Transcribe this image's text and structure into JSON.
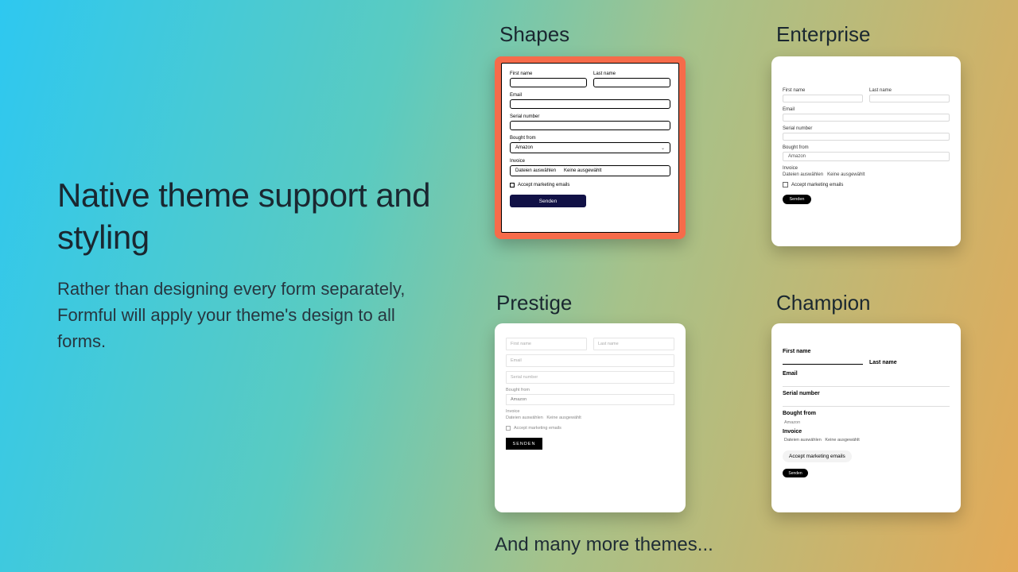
{
  "copy": {
    "heading": "Native theme support and styling",
    "sub": "Rather than designing every form separately, Formful will apply your theme's design to all forms."
  },
  "more": "And many more themes...",
  "themes": {
    "shapes": {
      "title": "Shapes"
    },
    "enterprise": {
      "title": "Enterprise"
    },
    "prestige": {
      "title": "Prestige"
    },
    "champion": {
      "title": "Champion"
    }
  },
  "labels": {
    "first": "First name",
    "last": "Last name",
    "email": "Email",
    "serial": "Serial number",
    "bought": "Bought from",
    "invoice": "Invoice",
    "amazon": "Amazon",
    "file_btn": "Dateien auswählen",
    "file_none": "Keine ausgewählt",
    "marketing": "Accept marketing emails",
    "send": "Senden",
    "send_upper": "SENDEN"
  }
}
